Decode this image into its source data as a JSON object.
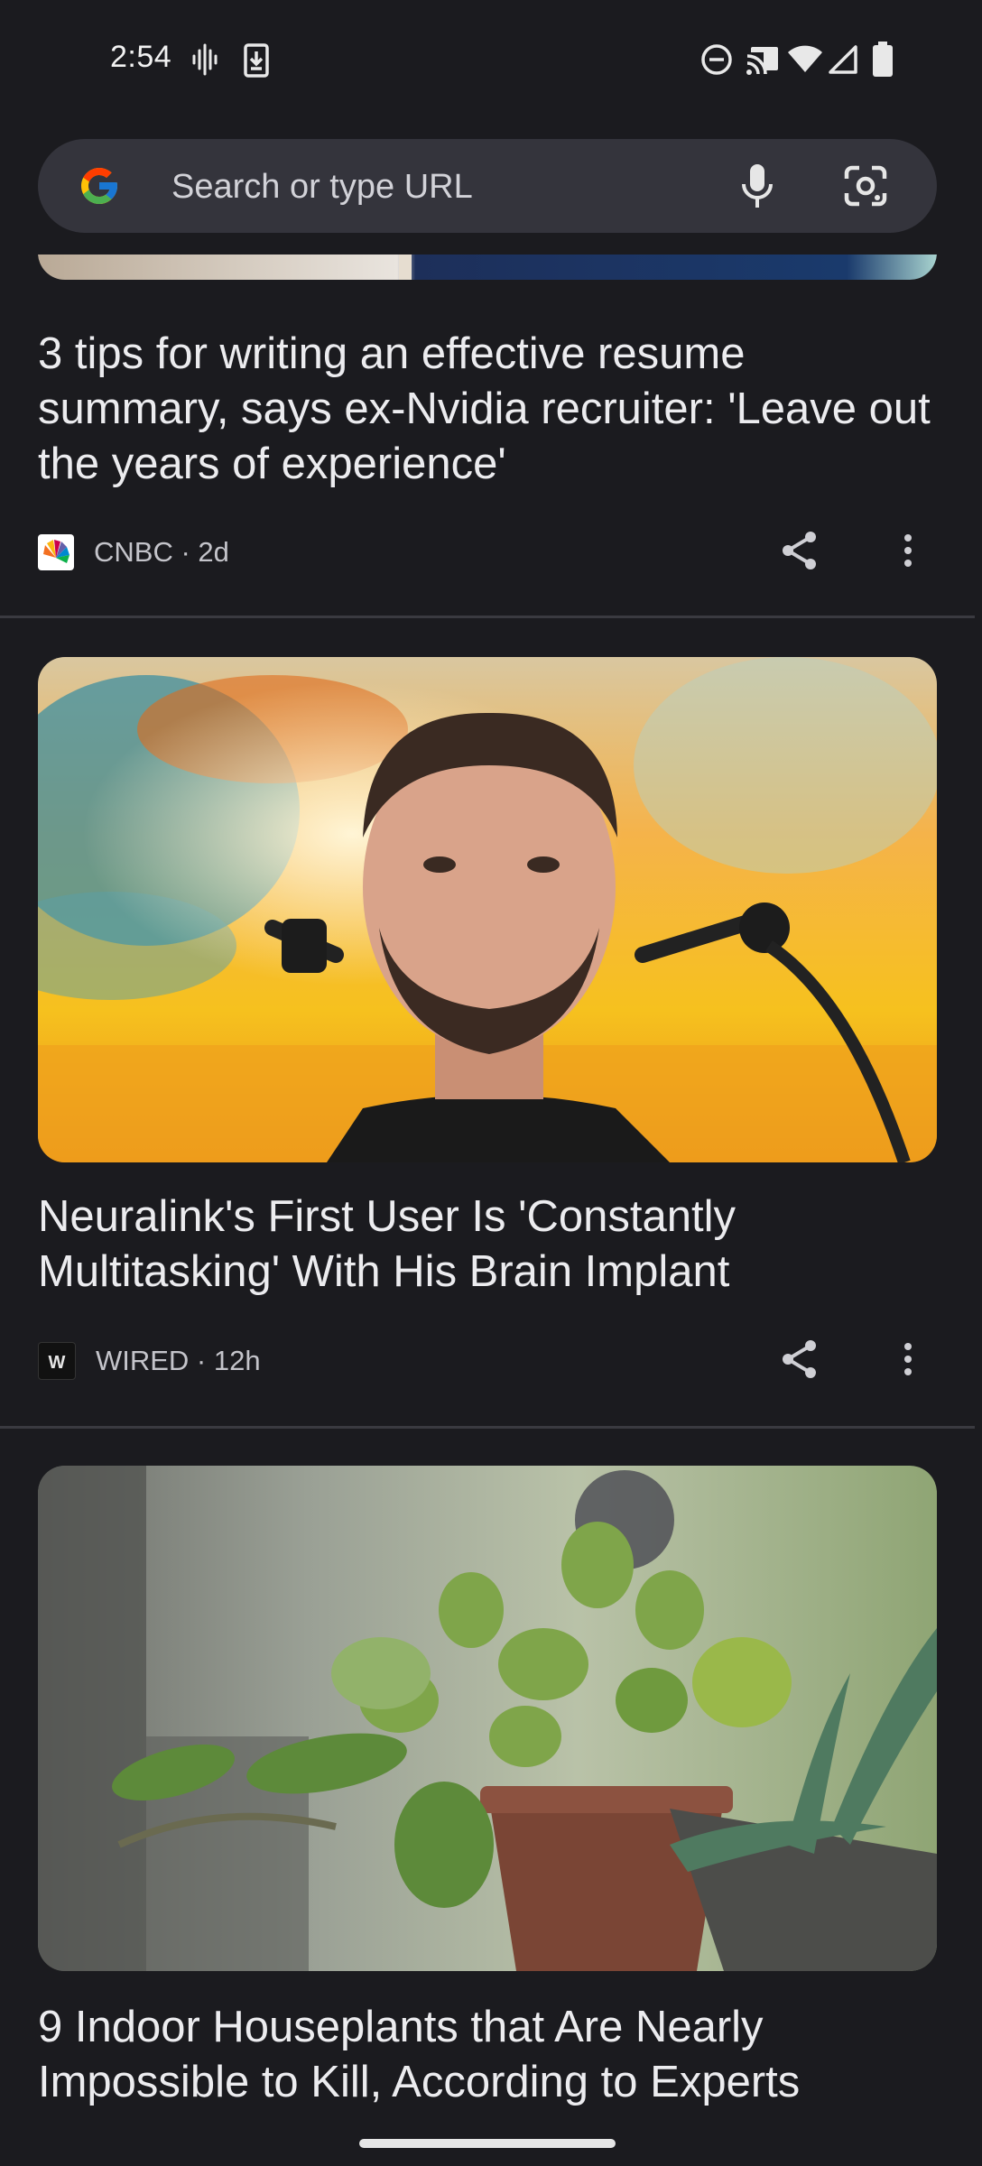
{
  "status_bar": {
    "time": "2:54",
    "icons": [
      "voicemail-waveform-icon",
      "download-icon",
      "dnd-icon",
      "cast-icon",
      "wifi-icon",
      "signal-icon",
      "battery-icon"
    ]
  },
  "search": {
    "placeholder": "Search or type URL",
    "icons": [
      "google-logo",
      "mic-icon",
      "lens-camera-icon"
    ]
  },
  "feed": {
    "articles": [
      {
        "headline": "3 tips for writing an effective resume summary, says ex-Nvidia recruiter: 'Leave out the years of experience'",
        "source": "CNBC",
        "age": "2d",
        "meta": "CNBC · 2d"
      },
      {
        "headline": "Neuralink's First User Is 'Constantly Multitasking' With His Brain Implant",
        "source": "WIRED",
        "age": "12h",
        "meta": "WIRED · 12h"
      },
      {
        "headline": "9 Indoor Houseplants that Are Nearly Impossible to Kill, According to Experts",
        "source": "",
        "age": "",
        "meta": ""
      }
    ]
  },
  "colors": {
    "background": "#1b1b1f",
    "search_bar": "#34343c",
    "text_primary": "#ececef",
    "text_secondary": "#c4c4ca"
  }
}
